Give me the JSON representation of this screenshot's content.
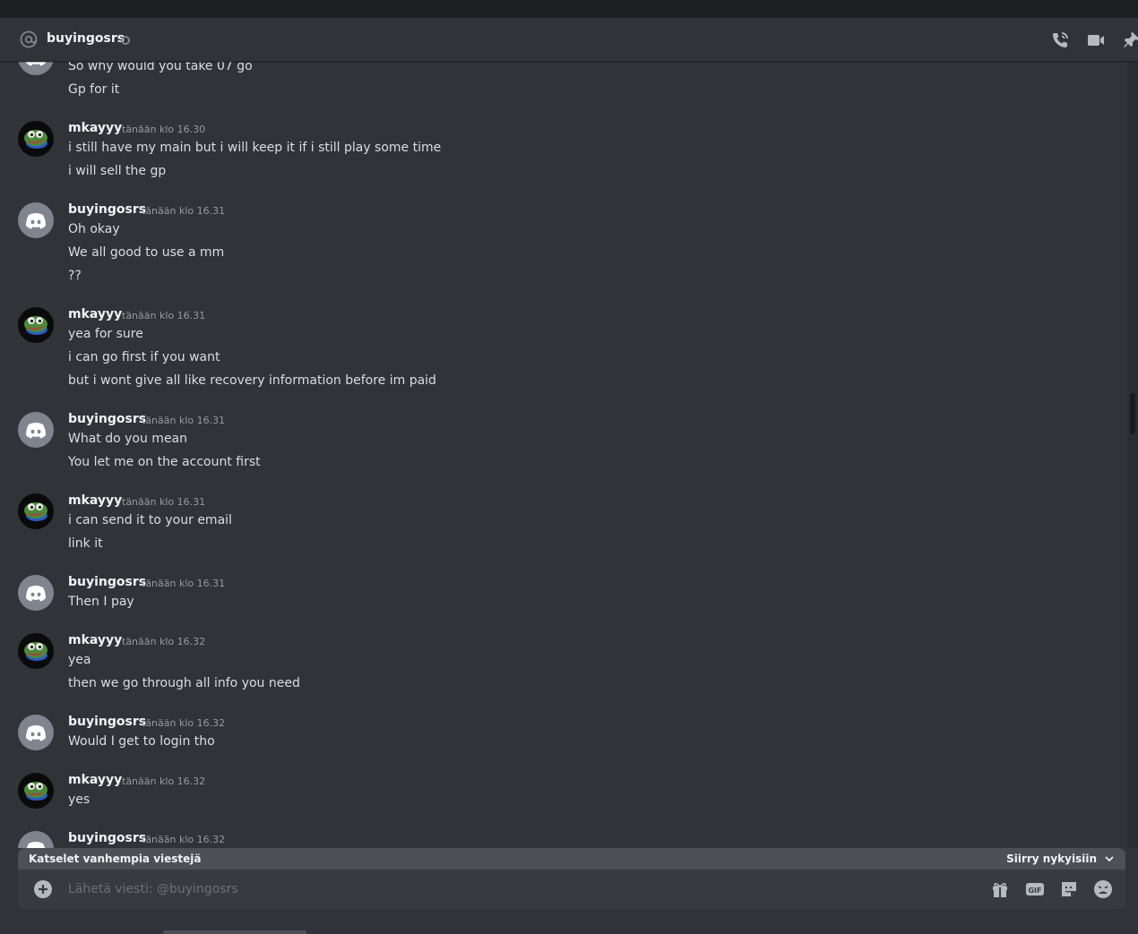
{
  "header": {
    "title": "buyingosrs"
  },
  "messages": [
    {
      "type": "cont",
      "lines": [
        "So why would you take 07 go",
        "Gp for it"
      ]
    },
    {
      "type": "group",
      "author": "mkayyy",
      "avatar": "pepe",
      "timestamp": "tänään klo 16.30",
      "lines": [
        "i still have my main but i will keep it if i still play some time",
        "i will sell the gp"
      ]
    },
    {
      "type": "group",
      "author": "buyingosrs",
      "avatar": "discord",
      "timestamp": "tänään klo 16.31",
      "lines": [
        "Oh okay",
        "We all good to use a mm",
        "??"
      ]
    },
    {
      "type": "group",
      "author": "mkayyy",
      "avatar": "pepe",
      "timestamp": "tänään klo 16.31",
      "lines": [
        "yea for sure",
        "i can go first if you want",
        "but i wont give all like recovery information before im paid"
      ]
    },
    {
      "type": "group",
      "author": "buyingosrs",
      "avatar": "discord",
      "timestamp": "tänään klo 16.31",
      "lines": [
        "What do you mean",
        "You let me on the account first"
      ]
    },
    {
      "type": "group",
      "author": "mkayyy",
      "avatar": "pepe",
      "timestamp": "tänään klo 16.31",
      "lines": [
        "i can send it to your email",
        "link it"
      ]
    },
    {
      "type": "group",
      "author": "buyingosrs",
      "avatar": "discord",
      "timestamp": "tänään klo 16.31",
      "lines": [
        "Then I pay"
      ]
    },
    {
      "type": "group",
      "author": "mkayyy",
      "avatar": "pepe",
      "timestamp": "tänään klo 16.32",
      "lines": [
        "yea",
        "then we go through all info you need"
      ]
    },
    {
      "type": "group",
      "author": "buyingosrs",
      "avatar": "discord",
      "timestamp": "tänään klo 16.32",
      "lines": [
        "Would I get to login tho"
      ]
    },
    {
      "type": "group",
      "author": "mkayyy",
      "avatar": "pepe",
      "timestamp": "tänään klo 16.32",
      "lines": [
        "yes"
      ]
    },
    {
      "type": "group",
      "author": "buyingosrs",
      "avatar": "discord",
      "timestamp": "tänään klo 16.32",
      "lines": []
    }
  ],
  "older_bar": {
    "text": "Katselet vanhempia viestejä",
    "jump_label": "Siirry nykyisiin"
  },
  "composer": {
    "placeholder": "Lähetä viesti: @buyingosrs"
  },
  "icons": {
    "header": [
      "at-icon",
      "call-icon",
      "video-icon",
      "pin-icon"
    ],
    "composer": [
      "plus-icon",
      "gift-icon",
      "gif-icon",
      "sticker-icon",
      "emoji-icon"
    ]
  }
}
